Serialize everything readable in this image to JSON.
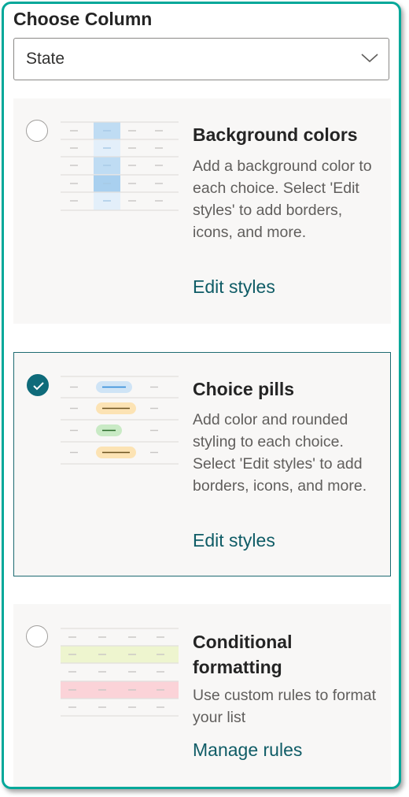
{
  "panel": {
    "title": "Choose Column",
    "column_dropdown": {
      "selected_value": "State",
      "icon": "chevron-down-icon"
    }
  },
  "options": [
    {
      "title": "Background colors",
      "description": "Add a background color to each choice. Select 'Edit styles' to add borders, icons, and more.",
      "link": "Edit styles",
      "selected": false
    },
    {
      "title": "Choice pills",
      "description": "Add color and rounded styling to each choice. Select 'Edit styles' to add borders, icons, and more.",
      "link": "Edit styles",
      "selected": true
    },
    {
      "title": "Conditional formatting",
      "description": "Use custom rules to format your list",
      "link": "Manage rules",
      "selected": false
    }
  ],
  "colors": {
    "frame_border": "#03a89a",
    "accent": "#0f6b7a",
    "link": "#0f5c66",
    "option_background": "#f8f7f6"
  }
}
